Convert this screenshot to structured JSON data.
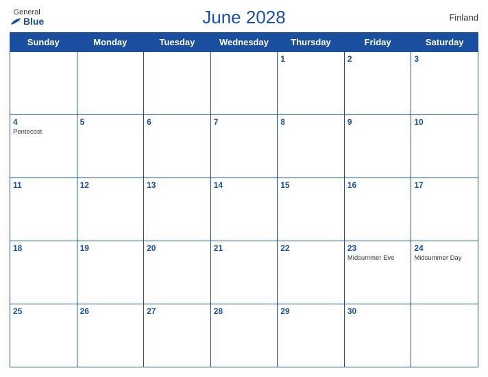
{
  "header": {
    "title": "June 2028",
    "country": "Finland",
    "logo": {
      "general": "General",
      "blue": "Blue"
    }
  },
  "weekdays": [
    "Sunday",
    "Monday",
    "Tuesday",
    "Wednesday",
    "Thursday",
    "Friday",
    "Saturday"
  ],
  "weeks": [
    [
      {
        "day": "",
        "holiday": ""
      },
      {
        "day": "",
        "holiday": ""
      },
      {
        "day": "",
        "holiday": ""
      },
      {
        "day": "",
        "holiday": ""
      },
      {
        "day": "1",
        "holiday": ""
      },
      {
        "day": "2",
        "holiday": ""
      },
      {
        "day": "3",
        "holiday": ""
      }
    ],
    [
      {
        "day": "4",
        "holiday": "Pentecost"
      },
      {
        "day": "5",
        "holiday": ""
      },
      {
        "day": "6",
        "holiday": ""
      },
      {
        "day": "7",
        "holiday": ""
      },
      {
        "day": "8",
        "holiday": ""
      },
      {
        "day": "9",
        "holiday": ""
      },
      {
        "day": "10",
        "holiday": ""
      }
    ],
    [
      {
        "day": "11",
        "holiday": ""
      },
      {
        "day": "12",
        "holiday": ""
      },
      {
        "day": "13",
        "holiday": ""
      },
      {
        "day": "14",
        "holiday": ""
      },
      {
        "day": "15",
        "holiday": ""
      },
      {
        "day": "16",
        "holiday": ""
      },
      {
        "day": "17",
        "holiday": ""
      }
    ],
    [
      {
        "day": "18",
        "holiday": ""
      },
      {
        "day": "19",
        "holiday": ""
      },
      {
        "day": "20",
        "holiday": ""
      },
      {
        "day": "21",
        "holiday": ""
      },
      {
        "day": "22",
        "holiday": ""
      },
      {
        "day": "23",
        "holiday": "Midsummer Eve"
      },
      {
        "day": "24",
        "holiday": "Midsummer Day"
      }
    ],
    [
      {
        "day": "25",
        "holiday": ""
      },
      {
        "day": "26",
        "holiday": ""
      },
      {
        "day": "27",
        "holiday": ""
      },
      {
        "day": "28",
        "holiday": ""
      },
      {
        "day": "29",
        "holiday": ""
      },
      {
        "day": "30",
        "holiday": ""
      },
      {
        "day": "",
        "holiday": ""
      }
    ]
  ]
}
